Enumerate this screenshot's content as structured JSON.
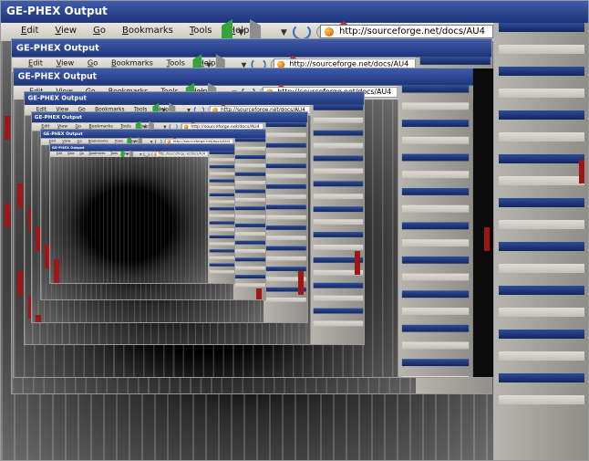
{
  "window": {
    "title": "GE-PHEX Output"
  },
  "menu": {
    "items": [
      "Edit",
      "View",
      "Go",
      "Bookmarks",
      "Tools",
      "Help"
    ]
  },
  "navigation": {
    "back_icon": "back-arrow-icon",
    "forward_icon": "forward-arrow-icon",
    "reload_icon": "reload-icon",
    "stop_icon": "stop-icon",
    "home_icon": "home-icon"
  },
  "address": {
    "url": "http://sourceforge.net/docs/AU4"
  },
  "theme": {
    "titlebar": "#1c3478",
    "toolbar": "#d7d4cb",
    "back": "#35a43a",
    "reload": "#2f6dc5",
    "highlight": "#a01515"
  }
}
